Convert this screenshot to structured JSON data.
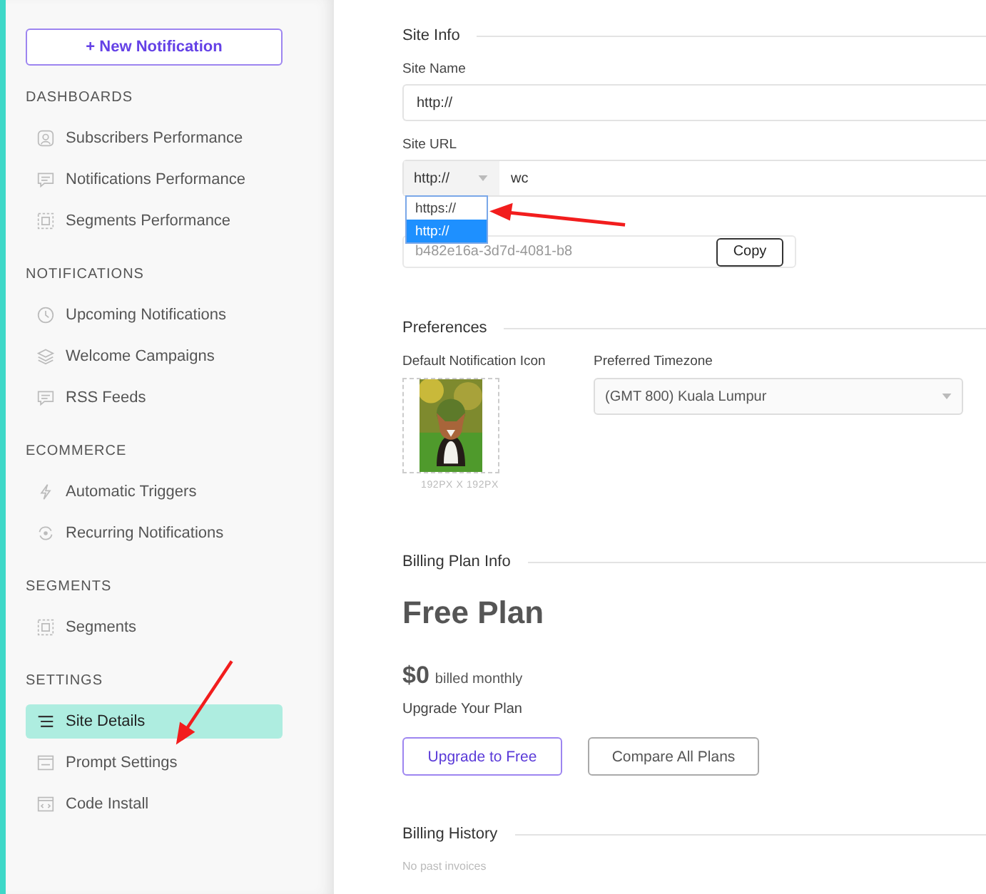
{
  "sidebar": {
    "new_button": "+ New Notification",
    "sections": [
      {
        "title": "DASHBOARDS",
        "items": [
          {
            "label": "Subscribers Performance",
            "selected": false
          },
          {
            "label": "Notifications Performance",
            "selected": false
          },
          {
            "label": "Segments Performance",
            "selected": false
          }
        ]
      },
      {
        "title": "NOTIFICATIONS",
        "items": [
          {
            "label": "Upcoming Notifications",
            "selected": false
          },
          {
            "label": "Welcome Campaigns",
            "selected": false
          },
          {
            "label": "RSS Feeds",
            "selected": false
          }
        ]
      },
      {
        "title": "ECOMMERCE",
        "items": [
          {
            "label": "Automatic Triggers",
            "selected": false
          },
          {
            "label": "Recurring Notifications",
            "selected": false
          }
        ]
      },
      {
        "title": "SEGMENTS",
        "items": [
          {
            "label": "Segments",
            "selected": false
          }
        ]
      },
      {
        "title": "SETTINGS",
        "items": [
          {
            "label": "Site Details",
            "selected": true
          },
          {
            "label": "Prompt Settings",
            "selected": false
          },
          {
            "label": "Code Install",
            "selected": false
          }
        ]
      }
    ]
  },
  "site_info": {
    "title": "Site Info",
    "site_name": {
      "label": "Site Name",
      "value": "http://"
    },
    "site_url": {
      "label": "Site URL",
      "protocol": "http://",
      "value": "wc",
      "expanded": true,
      "options": [
        {
          "label": "https://",
          "selected": false
        },
        {
          "label": "http://",
          "selected": true
        }
      ]
    },
    "key": {
      "value": "b482e16a-3d7d-4081-b8",
      "copy_button": "Copy"
    }
  },
  "preferences": {
    "title": "Preferences",
    "icon_label": "Default Notification Icon",
    "icon_size": "192PX X 192PX",
    "timezone_label": "Preferred Timezone",
    "timezone": "(GMT 800) Kuala Lumpur"
  },
  "billing": {
    "title": "Billing Plan Info",
    "plan": "Free Plan",
    "price": "$0",
    "period": "billed monthly",
    "upgrade_label": "Upgrade Your Plan",
    "buttons": [
      "Upgrade to Free",
      "Compare All Plans"
    ]
  },
  "history": {
    "title": "Billing History",
    "empty": "No past invoices"
  }
}
